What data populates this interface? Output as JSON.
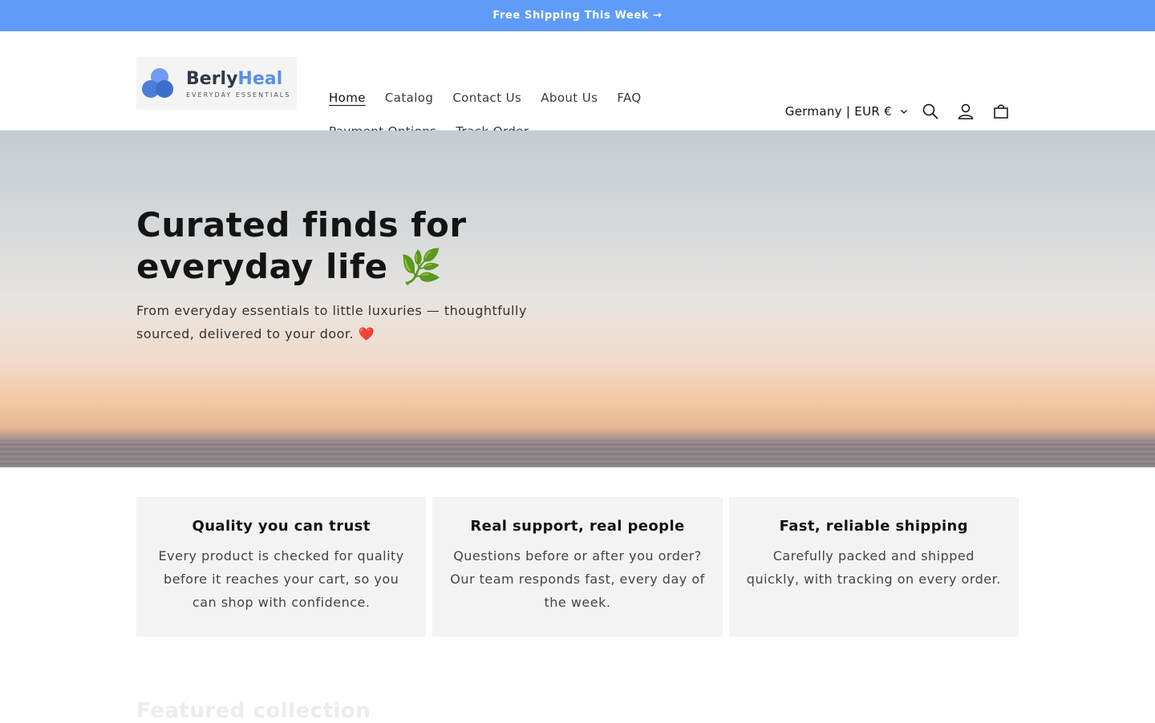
{
  "announcement": {
    "text": "Free Shipping This Week →"
  },
  "logo": {
    "brand_part1": "Berly",
    "brand_part2": "Heal",
    "tagline": "EVERYDAY ESSENTIALS"
  },
  "nav": {
    "row1": [
      {
        "label": "Home",
        "active": true
      },
      {
        "label": "Catalog"
      },
      {
        "label": "Contact Us"
      },
      {
        "label": "About Us"
      },
      {
        "label": "FAQ"
      }
    ],
    "row2": [
      {
        "label": "Payment Options"
      },
      {
        "label": "Track Order"
      }
    ]
  },
  "header": {
    "locale": "Germany | EUR €",
    "icons": [
      "chevron-down-icon",
      "search-icon",
      "account-icon",
      "cart-icon"
    ]
  },
  "hero": {
    "title_line1": "Curated finds for",
    "title_line2": "everyday life 🌿",
    "subtitle_line1": "From everyday essentials to little luxuries — thoughtfully",
    "subtitle_line2": "sourced, delivered to your door. ❤️"
  },
  "features": [
    {
      "title": "Quality you can trust",
      "text": "Every product is checked for quality before it reaches your cart, so you can shop with confidence."
    },
    {
      "title": "Real support, real people",
      "text": "Questions before or after you order? Our team responds fast, every day of the week."
    },
    {
      "title": "Fast, reliable shipping",
      "text": "Carefully packed and shipped quickly, with tracking on every order."
    }
  ],
  "featured_heading": "Featured collection",
  "colors": {
    "announcement_bg": "#5f9cf9",
    "card_bg": "#f3f3f3",
    "text": "#121212"
  }
}
